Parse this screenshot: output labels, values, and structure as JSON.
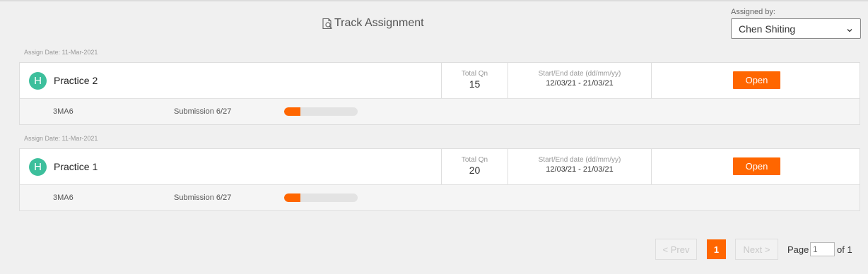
{
  "header": {
    "title": "Track Assignment",
    "title_icon": "search-document-icon"
  },
  "assigned_by": {
    "label": "Assigned by:",
    "selected": "Chen Shiting"
  },
  "assignments": [
    {
      "assign_date": "Assign Date: 11-Mar-2021",
      "avatar_letter": "H",
      "name": "Practice 2",
      "total_label": "Total Qn",
      "total_value": "15",
      "date_label": "Start/End date (dd/mm/yy)",
      "date_value": "12/03/21 - 21/03/21",
      "action_label": "Open",
      "class_name": "3MA6",
      "submission": "Submission 6/27",
      "progress": 0.222
    },
    {
      "assign_date": "Assign Date: 11-Mar-2021",
      "avatar_letter": "H",
      "name": "Practice 1",
      "total_label": "Total Qn",
      "total_value": "20",
      "date_label": "Start/End date (dd/mm/yy)",
      "date_value": "12/03/21 - 21/03/21",
      "action_label": "Open",
      "class_name": "3MA6",
      "submission": "Submission 6/27",
      "progress": 0.222
    }
  ],
  "pagination": {
    "prev_label": "< Prev",
    "current_page": "1",
    "next_label": "Next >",
    "page_label": "Page",
    "page_input_value": "1",
    "of_label": "of 1"
  },
  "colors": {
    "accent": "#ff6600",
    "avatar": "#3dbf9c",
    "background": "#f0f0f0"
  }
}
